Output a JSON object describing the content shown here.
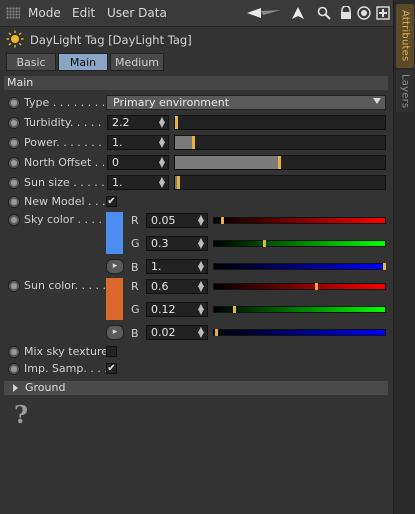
{
  "menubar": {
    "items": [
      "Mode",
      "Edit",
      "User Data"
    ]
  },
  "toolbar_icons": [
    "arrow-left-icon",
    "arrow-up-icon",
    "search-icon",
    "lock-icon",
    "target-icon",
    "new-window-icon"
  ],
  "object": {
    "title": "DayLight Tag [DayLight Tag]",
    "icon": "sun-icon"
  },
  "tabs": [
    "Basic",
    "Main",
    "Medium"
  ],
  "active_tab": "Main",
  "section": "Main",
  "fields": {
    "type": {
      "label": "Type . . . . . . . .",
      "value": "Primary environment"
    },
    "turbidity": {
      "label": "Turbidity. . . . .",
      "value": "2.2",
      "slider": 0.01
    },
    "power": {
      "label": "Power. . . . . . .",
      "value": "1.",
      "slider": 0.09
    },
    "north_offset": {
      "label": "North Offset . .",
      "value": "0",
      "slider": 0.5
    },
    "sun_size": {
      "label": "Sun size . . . . .",
      "value": "1.",
      "slider": 0.02
    },
    "new_model": {
      "label": "New Model . . .",
      "checked": true,
      "check_glyph": "✔"
    },
    "sky_color": {
      "label": "Sky color . . . .",
      "swatch": "#4b8ef0",
      "r": "0.05",
      "g": "0.3",
      "b": "1.",
      "r_frac": 0.05,
      "g_frac": 0.3,
      "b_frac": 1.0
    },
    "sun_color": {
      "label": "Sun color. . . . .",
      "swatch": "#d9692a",
      "r": "0.6",
      "g": "0.12",
      "b": "0.02",
      "r_frac": 0.6,
      "g_frac": 0.12,
      "b_frac": 0.02
    },
    "mix_sky_texture": {
      "label": "Mix sky texture",
      "checked": false
    },
    "imp_samp": {
      "label": "Imp. Samp. . . .",
      "checked": true,
      "check_glyph": "✔"
    }
  },
  "channels": {
    "r": "R",
    "g": "G",
    "b": "B"
  },
  "more_button": "▸",
  "group": {
    "label": "Ground"
  },
  "help_glyph": "?",
  "side_tabs": {
    "attributes": "Attributes",
    "layers": "Layers"
  },
  "colors": {
    "accent": "#e8b23a",
    "active_tab": "#8aa6c4"
  }
}
